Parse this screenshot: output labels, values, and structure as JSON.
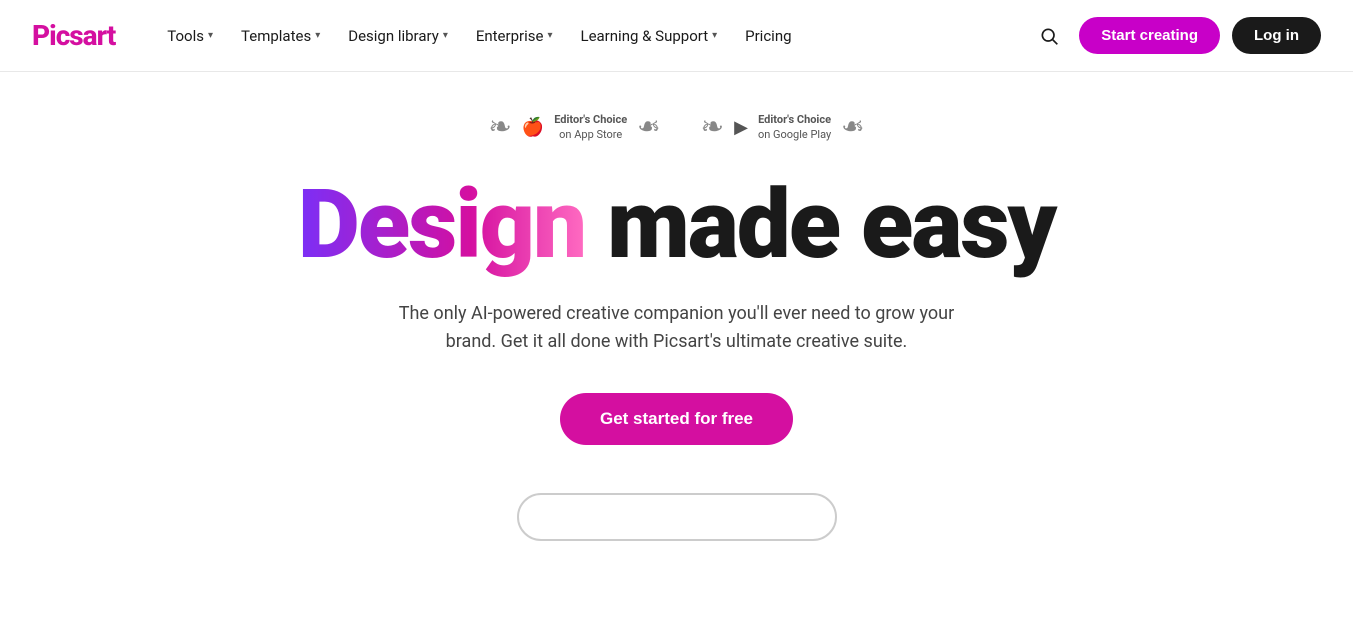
{
  "logo": {
    "text": "Picsart"
  },
  "nav": {
    "items": [
      {
        "label": "Tools",
        "hasDropdown": true
      },
      {
        "label": "Templates",
        "hasDropdown": true
      },
      {
        "label": "Design library",
        "hasDropdown": true
      },
      {
        "label": "Enterprise",
        "hasDropdown": true
      },
      {
        "label": "Learning & Support",
        "hasDropdown": true
      },
      {
        "label": "Pricing",
        "hasDropdown": false
      }
    ],
    "start_creating": "Start creating",
    "log_in": "Log in"
  },
  "badges": [
    {
      "icon": "🍎",
      "line1": "Editor's Choice",
      "line2": "on App Store"
    },
    {
      "icon": "▶",
      "line1": "Editor's Choice",
      "line2": "on Google Play"
    }
  ],
  "hero": {
    "title_gradient": "Design",
    "title_rest": " made easy",
    "subtitle": "The only AI-powered creative companion you'll ever need to grow your brand. Get it all done with Picsart's ultimate creative suite.",
    "cta": "Get started for free"
  },
  "colors": {
    "brand_pink": "#d40fa0",
    "brand_purple": "#7b2ff7",
    "dark": "#1a1a1a"
  }
}
